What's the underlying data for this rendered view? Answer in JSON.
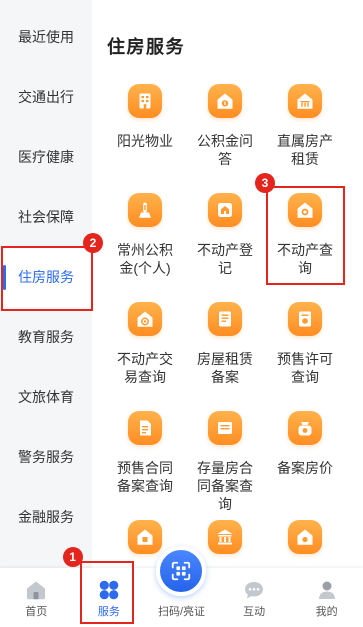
{
  "sidebar": {
    "items": [
      {
        "label": "最近使用"
      },
      {
        "label": "交通出行"
      },
      {
        "label": "医疗健康"
      },
      {
        "label": "社会保障"
      },
      {
        "label": "住房服务",
        "selected": true,
        "annotation": "2"
      },
      {
        "label": "教育服务"
      },
      {
        "label": "文旅体育"
      },
      {
        "label": "警务服务"
      },
      {
        "label": "金融服务"
      }
    ]
  },
  "main": {
    "title": "住房服务",
    "services": [
      {
        "label": "阳光物业",
        "icon": "building-icon"
      },
      {
        "label": "公积金问答",
        "icon": "house-coin-icon"
      },
      {
        "label": "直属房产租赁",
        "icon": "house-rent-icon"
      },
      {
        "label": "常州公积金(个人)",
        "icon": "tower-icon"
      },
      {
        "label": "不动产登记",
        "icon": "house-register-icon"
      },
      {
        "label": "不动产查询",
        "icon": "house-search-icon",
        "annotation": "3"
      },
      {
        "label": "不动产交易查询",
        "icon": "house-trade-icon"
      },
      {
        "label": "房屋租赁备案",
        "icon": "document-icon"
      },
      {
        "label": "预售许可查询",
        "icon": "permit-icon"
      },
      {
        "label": "预售合同备案查询",
        "icon": "contract-icon"
      },
      {
        "label": "存量房合同备案查询",
        "icon": "file-icon"
      },
      {
        "label": "备案房价",
        "icon": "price-icon"
      },
      {
        "icon": "house-icon"
      },
      {
        "icon": "bank-icon"
      },
      {
        "icon": "house-heart-icon"
      }
    ]
  },
  "tabbar": {
    "items": [
      {
        "label": "首页",
        "icon": "home-icon"
      },
      {
        "label": "服务",
        "icon": "services-grid-icon",
        "selected": true,
        "annotation": "1"
      },
      {
        "label": "扫码/亮证",
        "icon": "qr-scan-icon"
      },
      {
        "label": "互动",
        "icon": "chat-icon"
      },
      {
        "label": "我的",
        "icon": "user-icon"
      }
    ]
  },
  "colors": {
    "accent": "#2d6bea",
    "service_icon": "#ff9a2e",
    "annotation": "#e3251e",
    "sidebar_background": "#f5f6f8"
  }
}
